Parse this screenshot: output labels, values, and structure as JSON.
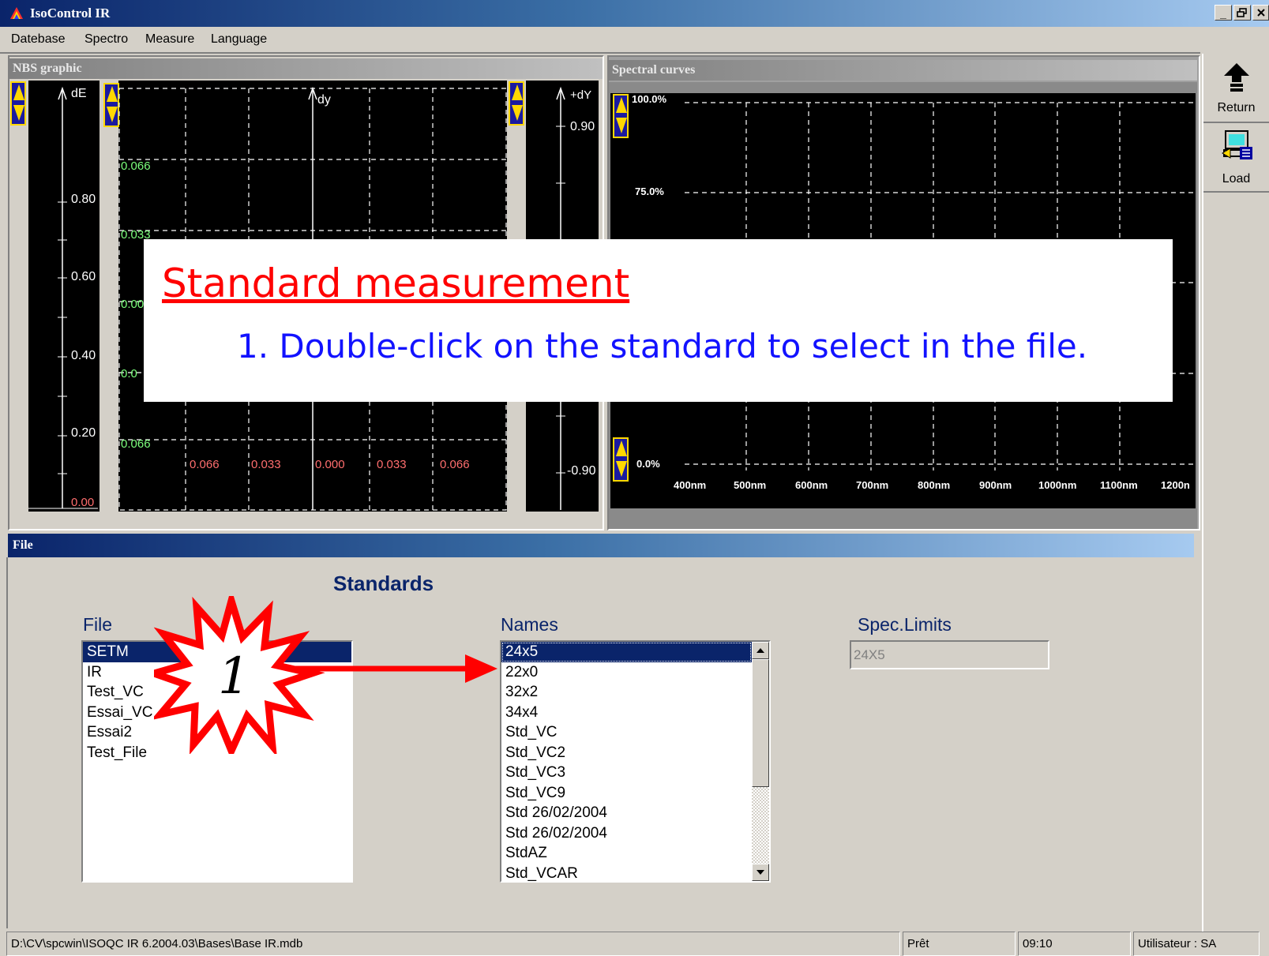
{
  "app": {
    "title": "IsoControl IR",
    "window_buttons": [
      "_",
      " "
    ]
  },
  "menu": [
    "Datebase",
    "Spectro",
    "Measure",
    "Language"
  ],
  "nbs": {
    "header": "NBS graphic",
    "de_label": "dE",
    "dy_label": "dy",
    "plus_dy_label": "+dY",
    "de_ticks": [
      "0.80",
      "0.60",
      "0.40",
      "0.20",
      "0.00"
    ],
    "dy_ticks": [
      "0.90",
      "-0.90"
    ],
    "green_labels": [
      "0.066",
      "0.033",
      "0.00",
      "0.0",
      "0.066"
    ],
    "red_labels": [
      "0.066",
      "0.033",
      "0.000",
      "0.033",
      "0.066"
    ]
  },
  "spectral": {
    "header": "Spectral curves",
    "y_labels": [
      "100.0%",
      "75.0%",
      "0.0%"
    ],
    "x_labels": [
      "400nm",
      "500nm",
      "600nm",
      "700nm",
      "800nm",
      "900nm",
      "1000nm",
      "1100nm",
      "1200n"
    ]
  },
  "toolbar": {
    "return_label": "Return",
    "load_label": "Load"
  },
  "file_panel": {
    "header": "File",
    "heading": "Standards",
    "file_label": "File",
    "names_label": "Names",
    "spec_label": "Spec.Limits",
    "spec_value": "24X5",
    "files": [
      "SETM",
      "IR",
      "Test_VC",
      "Essai_VC",
      "Essai2",
      "Test_File"
    ],
    "names": [
      "24x5",
      "22x0",
      "32x2",
      "34x4",
      "Std_VC",
      "Std_VC2",
      "Std_VC3",
      "Std_VC9",
      "Std 26/02/2004",
      "Std 26/02/2004",
      "StdAZ",
      "Std_VCAR"
    ]
  },
  "overlay": {
    "title": "Standard measurement",
    "step": "1. Double-click on the standard to select in the file.",
    "badge": "1"
  },
  "status": {
    "path": "D:\\CV\\spcwin\\ISOQC IR 6.2004.03\\Bases\\Base IR.mdb",
    "state": "Prêt",
    "time": "09:10",
    "user": "Utilisateur : SA"
  },
  "colors": {
    "title_blue": "#0a246a",
    "annotation_red": "#ff0000",
    "annotation_blue": "#1212ff",
    "selection": "#0a246a"
  }
}
